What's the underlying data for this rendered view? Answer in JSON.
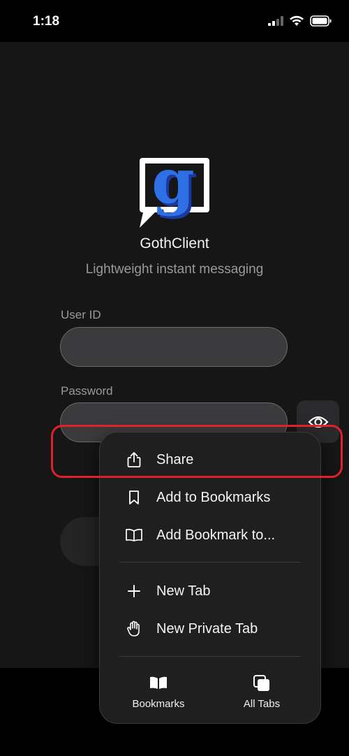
{
  "status_bar": {
    "time": "1:18"
  },
  "app": {
    "name": "GothClient",
    "tagline": "Lightweight instant messaging",
    "logo_letter": "g",
    "logo_color": "#2f6fe6"
  },
  "form": {
    "user_id_label": "User ID",
    "user_id_value": "",
    "password_label": "Password",
    "password_value": ""
  },
  "menu": {
    "items": [
      {
        "label": "Share",
        "icon": "share-icon"
      },
      {
        "label": "Add to Bookmarks",
        "icon": "bookmark-icon"
      },
      {
        "label": "Add Bookmark to...",
        "icon": "book-icon"
      },
      {
        "label": "New Tab",
        "icon": "plus-icon"
      },
      {
        "label": "New Private Tab",
        "icon": "hand-icon"
      }
    ],
    "tabs": [
      {
        "label": "Bookmarks",
        "icon": "bookmarks-book-icon"
      },
      {
        "label": "All Tabs",
        "icon": "tabs-icon"
      }
    ]
  },
  "highlight_color": "#e0202a"
}
